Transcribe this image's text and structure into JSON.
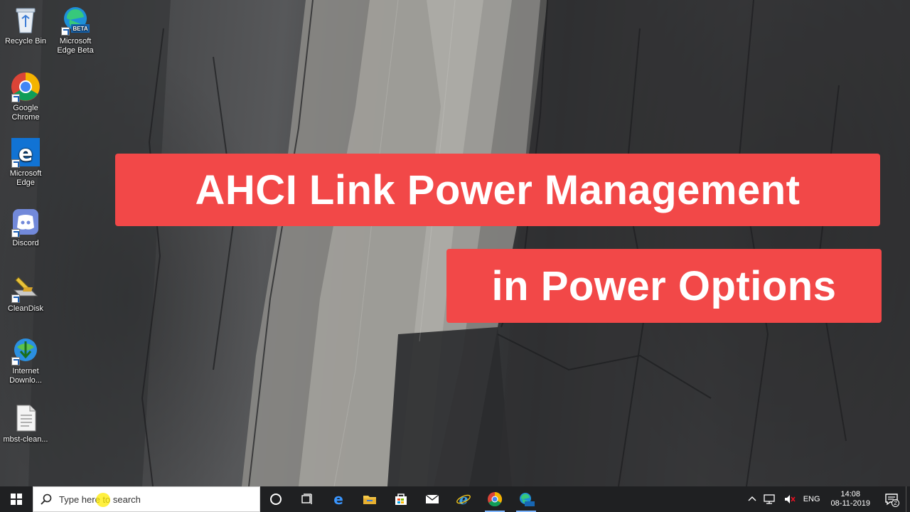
{
  "desktop": {
    "icons": [
      {
        "label": "Recycle Bin",
        "icon": "recycle-bin-icon"
      },
      {
        "label": "Microsoft Edge Beta",
        "icon": "edge-beta-icon",
        "badge": "BETA"
      },
      {
        "label": "Google Chrome",
        "icon": "chrome-icon"
      },
      {
        "label": "Microsoft Edge",
        "icon": "edge-icon"
      },
      {
        "label": "Discord",
        "icon": "discord-icon"
      },
      {
        "label": "CleanDisk",
        "icon": "cleandisk-icon"
      },
      {
        "label": "Internet Downlo...",
        "icon": "internet-download-manager-icon"
      },
      {
        "label": "mbst-clean...",
        "icon": "file-icon"
      }
    ]
  },
  "banners": {
    "line1": "AHCI Link Power Management",
    "line2": "in Power Options",
    "color": "#f24848"
  },
  "taskbar": {
    "search_placeholder": "Type here to search",
    "pinned": [
      "edge-icon",
      "file-explorer-icon",
      "store-icon",
      "mail-icon",
      "internet-explorer-icon",
      "chrome-icon",
      "edge-beta-icon"
    ],
    "tray": {
      "language": "ENG",
      "time": "14:08",
      "date": "08-11-2019",
      "notification_count": "2"
    }
  }
}
